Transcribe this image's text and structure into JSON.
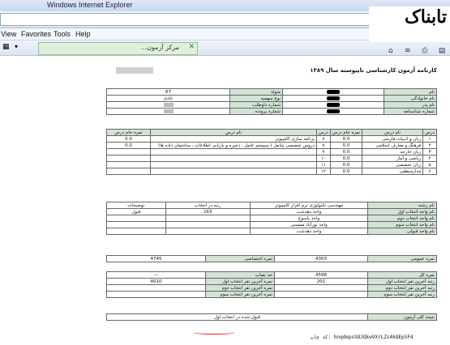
{
  "window": {
    "title": "Windows Internet Explorer"
  },
  "menu": {
    "view": "View",
    "favorites": "Favorites",
    "tools": "Tools",
    "help": "Help"
  },
  "tab": {
    "label": "...مرکز آزمون"
  },
  "logo": {
    "text": "تابناک"
  },
  "report": {
    "title": "کارنامه آزمون کارشناسی ناپیوسته سال ۱۳۸۹",
    "info_rows": [
      {
        "label1": "نام",
        "value1": "",
        "label2": "متولد",
        "value2": "67"
      },
      {
        "label1": "نام خانوادگی",
        "value1": "",
        "label2": "نوع سهمیه",
        "value2": "عادی"
      },
      {
        "label1": "نام پدر",
        "value1": "",
        "label2": "شماره داوطلب",
        "value2": ""
      },
      {
        "label1": "شماره شناسنامه",
        "value1": "",
        "label2": "شماره پرونده",
        "value2": ""
      }
    ],
    "course_header": [
      "درس",
      "نام درس",
      "نمره خام درس",
      "درس",
      "نام درس",
      "نمره خام درس"
    ],
    "course_rows": [
      {
        "n1": "۱",
        "name1": "زبان و ادبیات فارسی",
        "score1": "0.0",
        "n2": "۷",
        "name2": "برنامه سازی کامپیوتر",
        "score2": "0.0"
      },
      {
        "n1": "۲",
        "name1": "فرهنگ و معارف اسلامی",
        "score1": "0.0",
        "n2": "۸",
        "name2": "دروس تخصصی شامل ( سیستم عامل ، ذخیره و بازیابی اطلاعات ، ساختمان داده ها)",
        "score2": "0.0"
      },
      {
        "n1": "۳",
        "name1": "زبان خارجه",
        "score1": "0.0",
        "n2": "۹",
        "name2": "",
        "score2": ""
      },
      {
        "n1": "۴",
        "name1": "ریاضی و آمار",
        "score1": "0.0",
        "n2": "۱۰",
        "name2": "",
        "score2": ""
      },
      {
        "n1": "۵",
        "name1": "زبان تخصصی",
        "score1": "0.0",
        "n2": "۱۱",
        "name2": "",
        "score2": ""
      },
      {
        "n1": "۶",
        "name1": "مدارمنطقی",
        "score1": "0.0",
        "n2": "۱۲",
        "name2": "",
        "score2": ""
      }
    ],
    "field_header": [
      "نام رشته",
      "مهندسی تکنولوژی نرم افزار کامپیوتر",
      "رتبه در انتخاب",
      "توضیحات"
    ],
    "field_rows": [
      {
        "label": "نام واحد انتخاب اول",
        "unit": "واحد دهدشت",
        "rank": "163",
        "note": "قبول"
      },
      {
        "label": "نام واحد انتخاب دوم",
        "unit": "واحد یاسوج",
        "rank": "",
        "note": ""
      },
      {
        "label": "نام واحد انتخاب سوم",
        "unit": "واحد نورآباد ممسنی",
        "rank": "",
        "note": ""
      },
      {
        "label": "نام واحد قبولی",
        "unit": "واحد دهدشت",
        "rank": "",
        "note": ""
      }
    ],
    "score_row": {
      "label1": "نمره عمومی",
      "value1": "4303",
      "label2": "نمره اختصاصی",
      "value2": "4745"
    },
    "total_rows": [
      {
        "label1": "نمره کل",
        "value1": "4598",
        "label2": "حد نصاب",
        "value2": "---"
      },
      {
        "label1": "رتبه آخرین نفر انتخاب اول",
        "value1": "201",
        "label2": "نمره آخرین نفر انتخاب اول",
        "value2": "4010"
      },
      {
        "label1": "رتبه آخرین نفر انتخاب دوم",
        "value1": "",
        "label2": "نمره آخرین نفر انتخاب دوم",
        "value2": ""
      },
      {
        "label1": "رتبه آخرین نفر انتخاب سوم",
        "value1": "",
        "label2": "نمره آخرین نفر انتخاب سوم",
        "value2": ""
      }
    ],
    "result": {
      "label": "نتیجه کلی آزمون",
      "value": "قبول شده در انتخاب اول"
    },
    "print_code": "کد چاپ: hnqdepsSOJQkwVXrLZs4kQEpSF4"
  }
}
